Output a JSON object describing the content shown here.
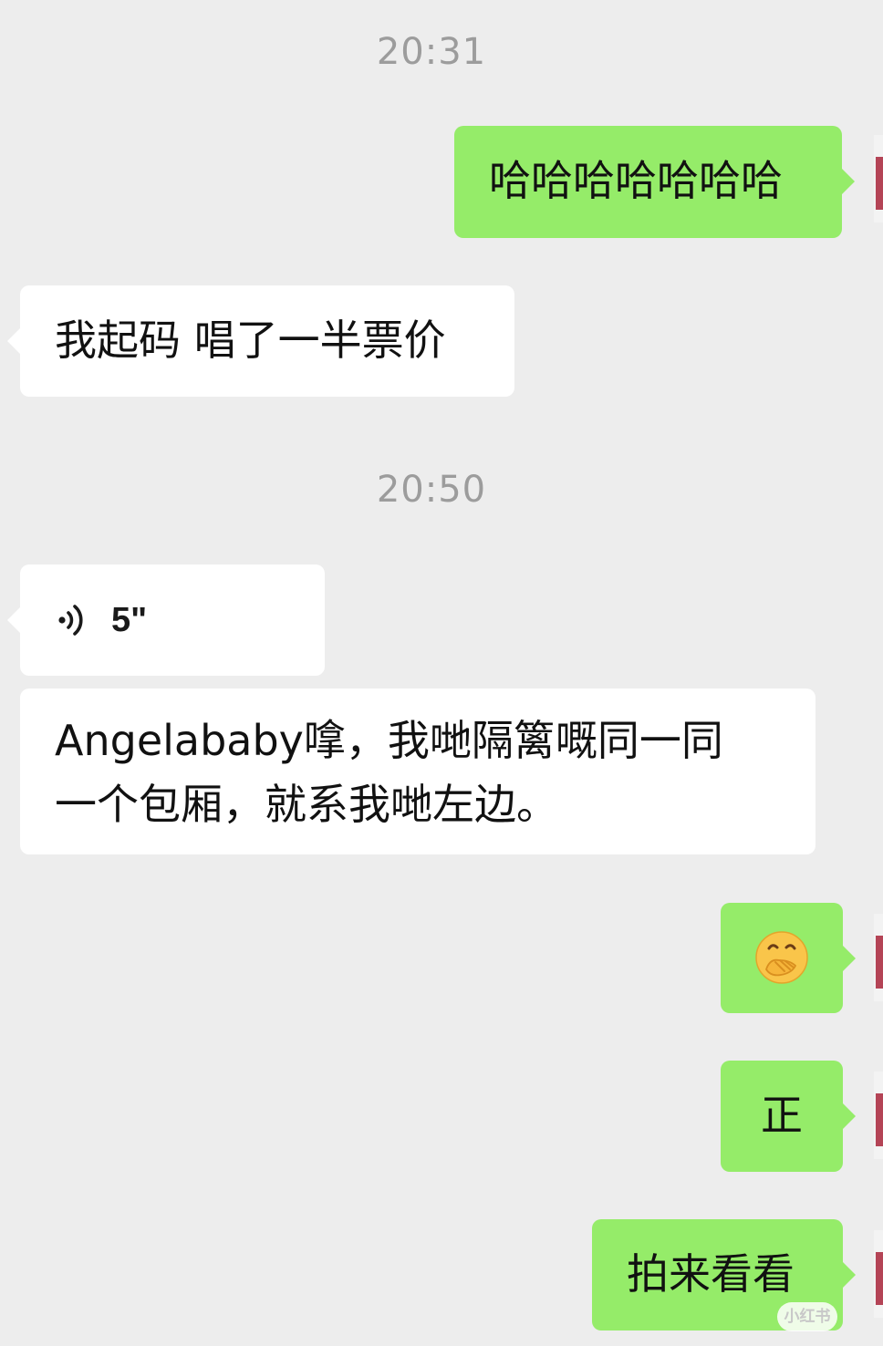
{
  "timestamps": [
    "20:31",
    "20:50"
  ],
  "messages": [
    {
      "direction": "outgoing",
      "type": "text",
      "text": "哈哈哈哈哈哈哈"
    },
    {
      "direction": "incoming",
      "type": "text",
      "text": "我起码 唱了一半票价"
    },
    {
      "direction": "incoming",
      "type": "voice",
      "icon": "voice-wave-icon",
      "duration": "5\""
    },
    {
      "direction": "incoming",
      "type": "text",
      "text": "Angelababy嗱，我哋隔篱嘅同一同\n一个包厢，就系我哋左边。"
    },
    {
      "direction": "outgoing",
      "type": "emoji",
      "icon": "face-with-hand-over-mouth-icon"
    },
    {
      "direction": "outgoing",
      "type": "text",
      "text": "正"
    },
    {
      "direction": "outgoing",
      "type": "text",
      "text": "拍来看看"
    }
  ],
  "watermark": "小红书",
  "colors": {
    "background": "#ededed",
    "outgoing_bubble": "#95ec69",
    "incoming_bubble": "#ffffff",
    "timestamp": "#9c9c9c"
  }
}
